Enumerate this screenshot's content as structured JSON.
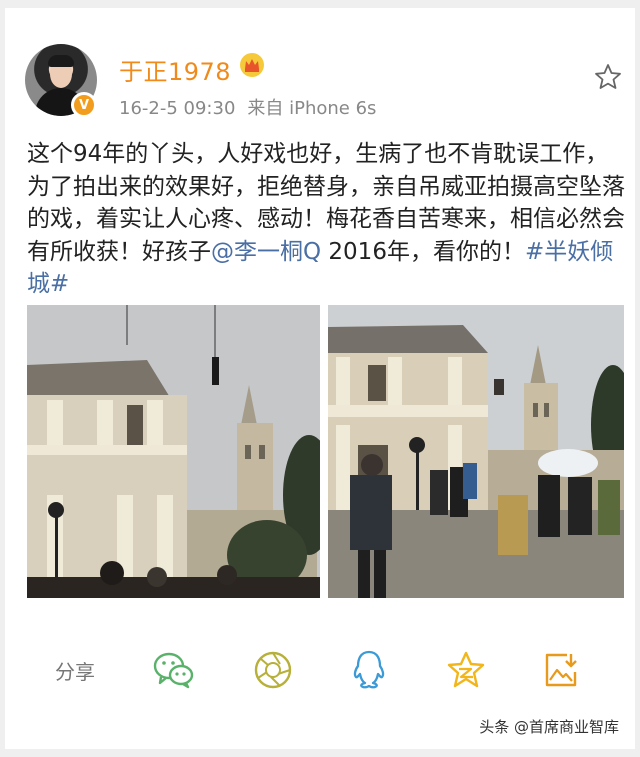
{
  "post": {
    "username": "于正1978",
    "timestamp": "16-2-5 09:30",
    "source": "来自 iPhone 6s",
    "text_before_mention": "这个94年的丫头，人好戏也好，生病了也不肯耽误工作，为了拍出来的效果好，拒绝替身，亲自吊威亚拍摄高空坠落的戏，着实让人心疼、感动！梅花香自苦寒来，相信必然会有所收获！好孩子",
    "mention": "@李一桐Q",
    "text_after_mention": " 2016年，看你的！",
    "hashtag": "#半妖倾城#",
    "verified_badge": "V"
  },
  "icons": {
    "avatar": "avatar",
    "crown": "crown-icon",
    "favorite": "star-outline-icon"
  },
  "actions": {
    "share_label": "分享",
    "items": [
      "wechat-icon",
      "moments-icon",
      "qq-icon",
      "qzone-icon",
      "image-save-icon"
    ]
  },
  "watermark": "头条 @首席商业智库",
  "colors": {
    "username": "#f08a1a",
    "link": "#4a6fa5",
    "wechat": "#5ab26a",
    "moments": "#b7b03a",
    "qq": "#3c9ad6",
    "qzone": "#f2b51a",
    "save": "#e79a1c"
  }
}
